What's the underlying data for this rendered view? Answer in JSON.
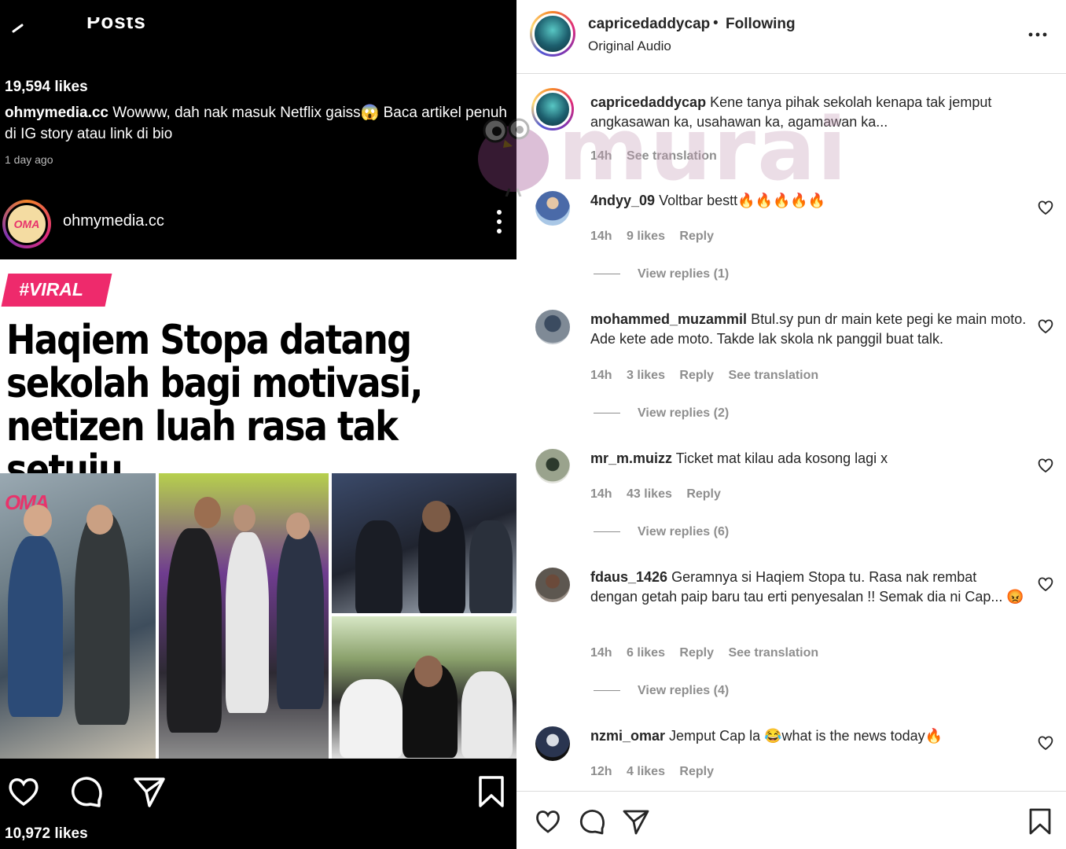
{
  "left": {
    "top_title": "Posts",
    "likes_top": "19,594 likes",
    "caption_user": "ohmymedia.cc",
    "caption_text": "Wowww, dah nak masuk Netflix gaiss😱 Baca artikel penuh di IG story atau link di bio",
    "time_ago": "1 day ago",
    "post_user": "ohmymedia.cc",
    "avatar_text": "OMA",
    "image": {
      "tag": "#VIRAL",
      "headline": "Haqiem Stopa datang sekolah bagi motivasi, netizen luah rasa tak setuju",
      "logo": "OMA"
    },
    "likes_bottom": "10,972 likes"
  },
  "right": {
    "header": {
      "username": "capricedaddycap",
      "separator": "•",
      "follow_status": "Following",
      "audio": "Original Audio"
    },
    "caption": {
      "username": "capricedaddycap",
      "text": "Kene tanya pihak sekolah kenapa tak jemput angkasawan ka, usahawan ka, agamawan ka...",
      "time": "14h",
      "translate": "See translation"
    },
    "comments": [
      {
        "username": "4ndyy_09",
        "text": "Voltbar bestt🔥🔥🔥🔥🔥",
        "time": "14h",
        "likes": "9 likes",
        "reply": "Reply",
        "translate": "",
        "replies": "View replies (1)"
      },
      {
        "username": "mohammed_muzammil",
        "text": "Btul.sy pun dr main kete pegi ke main moto. Ade kete ade moto. Takde lak skola nk panggil buat talk.",
        "time": "14h",
        "likes": "3 likes",
        "reply": "Reply",
        "translate": "See translation",
        "replies": "View replies (2)"
      },
      {
        "username": "mr_m.muizz",
        "text": "Ticket mat kilau ada kosong lagi x",
        "time": "14h",
        "likes": "43 likes",
        "reply": "Reply",
        "translate": "",
        "replies": "View replies (6)"
      },
      {
        "username": "fdaus_1426",
        "text": "Geramnya si Haqiem Stopa tu. Rasa nak rembat dengan getah paip baru tau erti penyesalan !! Semak dia ni Cap... 😡",
        "time": "14h",
        "likes": "6 likes",
        "reply": "Reply",
        "translate": "See translation",
        "replies": "View replies (4)"
      },
      {
        "username": "nzmi_omar",
        "text": "Jemput Cap la 😂what is the news today🔥",
        "time": "12h",
        "likes": "4 likes",
        "reply": "Reply",
        "translate": "",
        "replies": ""
      }
    ]
  },
  "watermark": "murai",
  "colors": {
    "viral_pink": "#ee2a6c",
    "meta_gray": "#8e8e8e",
    "text_dark": "#262626"
  }
}
